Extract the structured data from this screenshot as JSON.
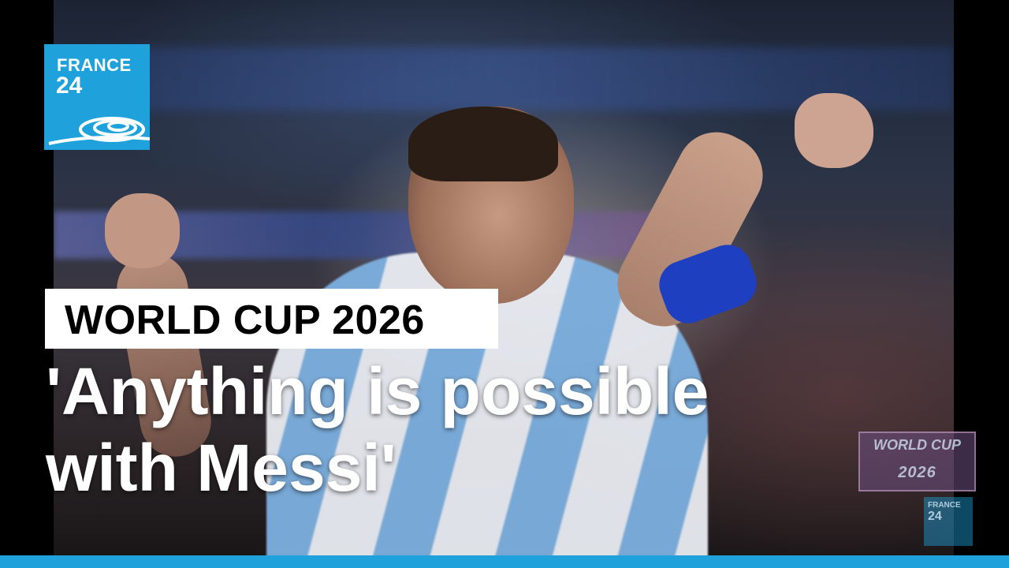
{
  "logo": {
    "line1": "FRANCE",
    "line2": "24"
  },
  "kicker": "WORLD CUP 2026",
  "headline": {
    "line1": "'Anything is possible",
    "line2": "with Messi'"
  },
  "badge": {
    "line1": "WORLD CUP",
    "line2": "2026"
  },
  "watermark_logo": {
    "line1": "FRANCE",
    "line2": "24"
  },
  "colors": {
    "brand": "#1fa1dc",
    "kicker_bg": "#ffffff",
    "kicker_text": "#000000"
  }
}
